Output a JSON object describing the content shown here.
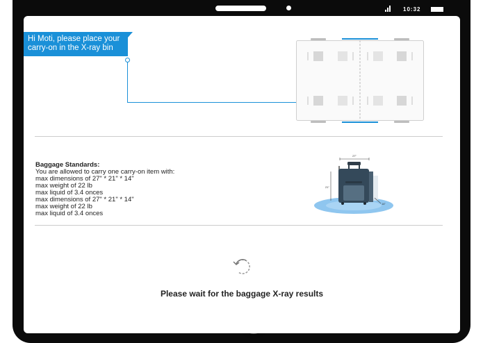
{
  "status_bar": {
    "time": "10:32"
  },
  "bubble": {
    "text": "Hi Moti, please place your carry-on in the X-ray bin"
  },
  "standards": {
    "title": "Baggage Standards:",
    "lines": [
      "You are allowed to carry one carry-on item with:",
      "max dimensions of 27\" * 21\" * 14\"",
      "max weight of 22 lb",
      "max liquid of 3.4 onces",
      "max dimensions of 27\" * 21\" * 14\"",
      "max weight of 22 lb",
      "max liquid of 3.4 onces"
    ]
  },
  "luggage_dims": {
    "width": "27\"",
    "height": "21\"",
    "depth": "14\""
  },
  "wait_message": "Please wait for the baggage X-ray results",
  "colors": {
    "accent": "#1a90d8",
    "device": "#0b0b0b",
    "luggage": "#34495a"
  },
  "icons": {
    "spinner": "rotate-refresh-icon",
    "home": "home-button-icon",
    "signal": "signal-icon",
    "battery": "battery-icon"
  }
}
